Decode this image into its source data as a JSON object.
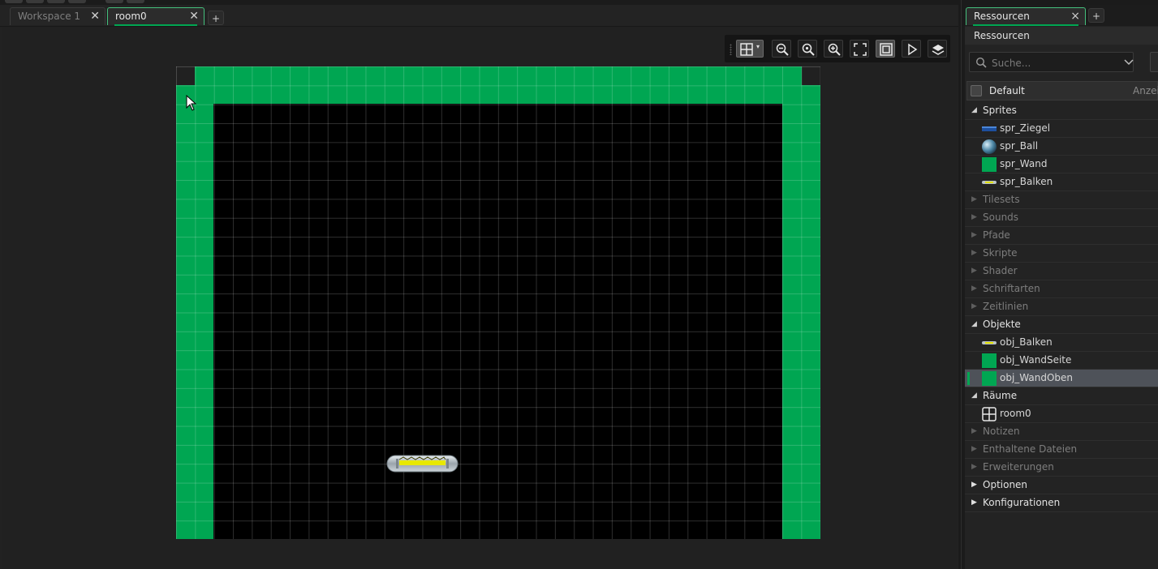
{
  "tabs": {
    "items": [
      {
        "label": "Workspace 1",
        "active": false
      },
      {
        "label": "room0",
        "active": true
      }
    ],
    "add_label": "+"
  },
  "room_toolbar": {
    "buttons": [
      {
        "name": "grid-toggle",
        "icon": "grid-icon",
        "active": true
      },
      {
        "name": "zoom-out",
        "icon": "zoom-out-icon",
        "active": false
      },
      {
        "name": "zoom-reset",
        "icon": "zoom-reset-icon",
        "active": false
      },
      {
        "name": "zoom-in",
        "icon": "zoom-in-icon",
        "active": false
      },
      {
        "name": "fit-view",
        "icon": "fit-icon",
        "active": false
      },
      {
        "name": "view-mode",
        "icon": "frame-icon",
        "active": true
      },
      {
        "name": "run-room",
        "icon": "play-icon",
        "active": false
      },
      {
        "name": "layers",
        "icon": "layers-icon",
        "active": false
      }
    ]
  },
  "colors": {
    "wall": "#00a652",
    "accent": "#00a652",
    "selection": "#4e5259"
  },
  "resources": {
    "tab_label": "Ressourcen",
    "close_label": "×",
    "add_label": "+",
    "panel_title": "Ressourcen",
    "search_placeholder": "Suche...",
    "default_label": "Default",
    "default_right": "Anzei",
    "groups": [
      {
        "label": "Sprites",
        "expanded": true,
        "children": [
          {
            "label": "spr_Ziegel",
            "icon": "brick-icon"
          },
          {
            "label": "spr_Ball",
            "icon": "ball-icon"
          },
          {
            "label": "spr_Wand",
            "icon": "wall-icon"
          },
          {
            "label": "spr_Balken",
            "icon": "paddle-icon"
          }
        ]
      },
      {
        "label": "Tilesets",
        "expanded": false,
        "children": []
      },
      {
        "label": "Sounds",
        "expanded": false,
        "children": []
      },
      {
        "label": "Pfade",
        "expanded": false,
        "children": []
      },
      {
        "label": "Skripte",
        "expanded": false,
        "children": []
      },
      {
        "label": "Shader",
        "expanded": false,
        "children": []
      },
      {
        "label": "Schriftarten",
        "expanded": false,
        "children": []
      },
      {
        "label": "Zeitlinien",
        "expanded": false,
        "children": []
      },
      {
        "label": "Objekte",
        "expanded": true,
        "children": [
          {
            "label": "obj_Balken",
            "icon": "paddle-icon"
          },
          {
            "label": "obj_WandSeite",
            "icon": "wall-icon"
          },
          {
            "label": "obj_WandOben",
            "icon": "wall-icon",
            "selected": true
          }
        ]
      },
      {
        "label": "Räume",
        "expanded": true,
        "children": [
          {
            "label": "room0",
            "icon": "room-icon"
          }
        ]
      },
      {
        "label": "Notizen",
        "expanded": false,
        "children": []
      },
      {
        "label": "Enthaltene Dateien",
        "expanded": false,
        "children": []
      },
      {
        "label": "Erweiterungen",
        "expanded": false,
        "children": []
      },
      {
        "label": "Optionen",
        "expanded": false,
        "bright": true,
        "children": []
      },
      {
        "label": "Konfigurationen",
        "expanded": false,
        "bright": true,
        "children": []
      }
    ]
  }
}
